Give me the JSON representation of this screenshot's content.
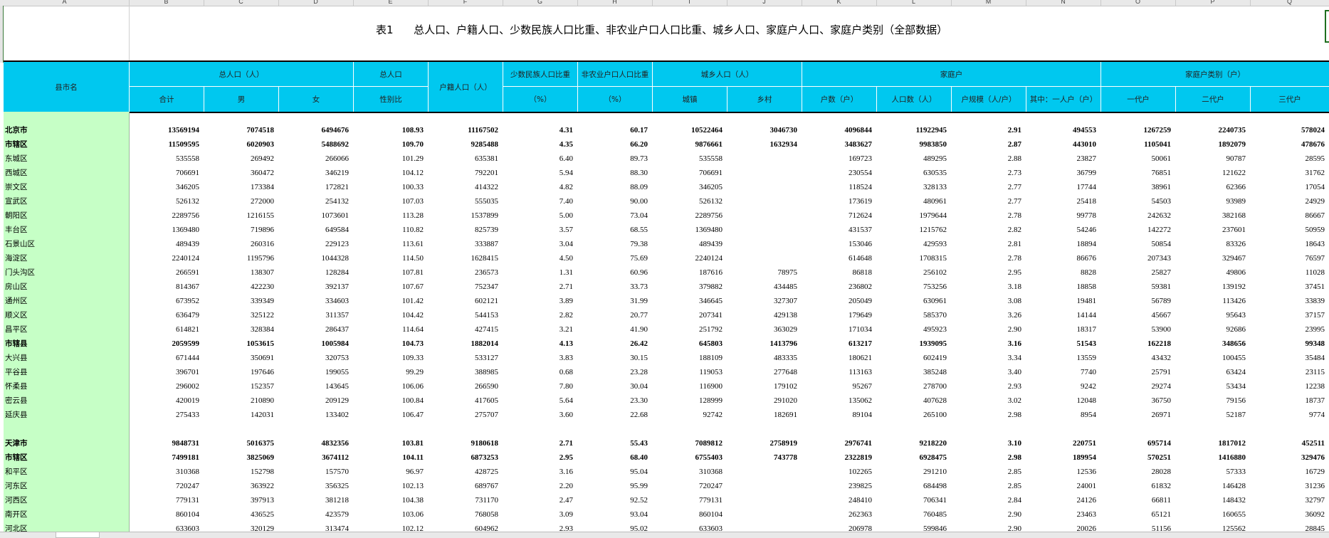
{
  "column_letters": [
    "A",
    "B",
    "C",
    "D",
    "E",
    "F",
    "G",
    "H",
    "I",
    "J",
    "K",
    "L",
    "M",
    "N",
    "O",
    "P",
    "Q"
  ],
  "title": "表1      总人口、户籍人口、少数民族人口比重、非农业户口人口比重、城乡人口、家庭户人口、家庭户类别（全部数据）",
  "header": {
    "region": "县市名",
    "groups": {
      "total_pop": "总人口（人）",
      "sex_ratio": "总人口",
      "household_reg": "户籍人口（人）",
      "minority": "少数民族人口比重",
      "nonagri": "非农业户口人口比重",
      "urban_rural": "城乡人口（人）",
      "household": "家庭户",
      "household_type": "家庭户类别（户）"
    },
    "sub": {
      "total": "合计",
      "male": "男",
      "female": "女",
      "sex_ratio": "性别比",
      "minority_pct": "（%）",
      "nonagri_pct": "（%）",
      "urban": "城镇",
      "rural": "乡村",
      "hh_count": "户数（户）",
      "hh_pop": "人口数（人）",
      "hh_size": "户规模（人/户）",
      "hh_single": "其中：一人户（户）",
      "gen1": "一代户",
      "gen2": "二代户",
      "gen3": "三代户"
    }
  },
  "rows": [
    {
      "name": "北京市",
      "bold": true,
      "v": [
        "13569194",
        "7074518",
        "6494676",
        "108.93",
        "11167502",
        "4.31",
        "60.17",
        "10522464",
        "3046730",
        "4096844",
        "11922945",
        "2.91",
        "494553",
        "1267259",
        "2240735",
        "578024"
      ]
    },
    {
      "name": "市辖区",
      "bold": true,
      "v": [
        "11509595",
        "6020903",
        "5488692",
        "109.70",
        "9285488",
        "4.35",
        "66.20",
        "9876661",
        "1632934",
        "3483627",
        "9983850",
        "2.87",
        "443010",
        "1105041",
        "1892079",
        "478676"
      ]
    },
    {
      "name": "东城区",
      "bold": false,
      "v": [
        "535558",
        "269492",
        "266066",
        "101.29",
        "635381",
        "6.40",
        "89.73",
        "535558",
        "",
        "169723",
        "489295",
        "2.88",
        "23827",
        "50061",
        "90787",
        "28595"
      ]
    },
    {
      "name": "西城区",
      "bold": false,
      "v": [
        "706691",
        "360472",
        "346219",
        "104.12",
        "792201",
        "5.94",
        "88.30",
        "706691",
        "",
        "230554",
        "630535",
        "2.73",
        "36799",
        "76851",
        "121622",
        "31762"
      ]
    },
    {
      "name": "崇文区",
      "bold": false,
      "v": [
        "346205",
        "173384",
        "172821",
        "100.33",
        "414322",
        "4.82",
        "88.09",
        "346205",
        "",
        "118524",
        "328133",
        "2.77",
        "17744",
        "38961",
        "62366",
        "17054"
      ]
    },
    {
      "name": "宣武区",
      "bold": false,
      "v": [
        "526132",
        "272000",
        "254132",
        "107.03",
        "555035",
        "7.40",
        "90.00",
        "526132",
        "",
        "173619",
        "480961",
        "2.77",
        "25418",
        "54503",
        "93989",
        "24929"
      ]
    },
    {
      "name": "朝阳区",
      "bold": false,
      "v": [
        "2289756",
        "1216155",
        "1073601",
        "113.28",
        "1537899",
        "5.00",
        "73.04",
        "2289756",
        "",
        "712624",
        "1979644",
        "2.78",
        "99778",
        "242632",
        "382168",
        "86667"
      ]
    },
    {
      "name": "丰台区",
      "bold": false,
      "v": [
        "1369480",
        "719896",
        "649584",
        "110.82",
        "825739",
        "3.57",
        "68.55",
        "1369480",
        "",
        "431537",
        "1215762",
        "2.82",
        "54246",
        "142272",
        "237601",
        "50959"
      ]
    },
    {
      "name": "石景山区",
      "bold": false,
      "v": [
        "489439",
        "260316",
        "229123",
        "113.61",
        "333887",
        "3.04",
        "79.38",
        "489439",
        "",
        "153046",
        "429593",
        "2.81",
        "18894",
        "50854",
        "83326",
        "18643"
      ]
    },
    {
      "name": "海淀区",
      "bold": false,
      "v": [
        "2240124",
        "1195796",
        "1044328",
        "114.50",
        "1628415",
        "4.50",
        "75.69",
        "2240124",
        "",
        "614648",
        "1708315",
        "2.78",
        "86676",
        "207343",
        "329467",
        "76597"
      ]
    },
    {
      "name": "门头沟区",
      "bold": false,
      "v": [
        "266591",
        "138307",
        "128284",
        "107.81",
        "236573",
        "1.31",
        "60.96",
        "187616",
        "78975",
        "86818",
        "256102",
        "2.95",
        "8828",
        "25827",
        "49806",
        "11028"
      ]
    },
    {
      "name": "房山区",
      "bold": false,
      "v": [
        "814367",
        "422230",
        "392137",
        "107.67",
        "752347",
        "2.71",
        "33.73",
        "379882",
        "434485",
        "236802",
        "753256",
        "3.18",
        "18858",
        "59381",
        "139192",
        "37451"
      ]
    },
    {
      "name": "通州区",
      "bold": false,
      "v": [
        "673952",
        "339349",
        "334603",
        "101.42",
        "602121",
        "3.89",
        "31.99",
        "346645",
        "327307",
        "205049",
        "630961",
        "3.08",
        "19481",
        "56789",
        "113426",
        "33839"
      ]
    },
    {
      "name": "顺义区",
      "bold": false,
      "v": [
        "636479",
        "325122",
        "311357",
        "104.42",
        "544153",
        "2.82",
        "20.77",
        "207341",
        "429138",
        "179649",
        "585370",
        "3.26",
        "14144",
        "45667",
        "95643",
        "37157"
      ]
    },
    {
      "name": "昌平区",
      "bold": false,
      "v": [
        "614821",
        "328384",
        "286437",
        "114.64",
        "427415",
        "3.21",
        "41.90",
        "251792",
        "363029",
        "171034",
        "495923",
        "2.90",
        "18317",
        "53900",
        "92686",
        "23995"
      ]
    },
    {
      "name": "市辖县",
      "bold": true,
      "v": [
        "2059599",
        "1053615",
        "1005984",
        "104.73",
        "1882014",
        "4.13",
        "26.42",
        "645803",
        "1413796",
        "613217",
        "1939095",
        "3.16",
        "51543",
        "162218",
        "348656",
        "99348"
      ]
    },
    {
      "name": "大兴县",
      "bold": false,
      "v": [
        "671444",
        "350691",
        "320753",
        "109.33",
        "533127",
        "3.83",
        "30.15",
        "188109",
        "483335",
        "180621",
        "602419",
        "3.34",
        "13559",
        "43432",
        "100455",
        "35484"
      ]
    },
    {
      "name": "平谷县",
      "bold": false,
      "v": [
        "396701",
        "197646",
        "199055",
        "99.29",
        "388985",
        "0.68",
        "23.28",
        "119053",
        "277648",
        "113163",
        "385248",
        "3.40",
        "7740",
        "25791",
        "63424",
        "23115"
      ]
    },
    {
      "name": "怀柔县",
      "bold": false,
      "v": [
        "296002",
        "152357",
        "143645",
        "106.06",
        "266590",
        "7.80",
        "30.04",
        "116900",
        "179102",
        "95267",
        "278700",
        "2.93",
        "9242",
        "29274",
        "53434",
        "12238"
      ]
    },
    {
      "name": "密云县",
      "bold": false,
      "v": [
        "420019",
        "210890",
        "209129",
        "100.84",
        "417605",
        "5.64",
        "23.30",
        "128999",
        "291020",
        "135062",
        "407628",
        "3.02",
        "12048",
        "36750",
        "79156",
        "18737"
      ]
    },
    {
      "name": "延庆县",
      "bold": false,
      "v": [
        "275433",
        "142031",
        "133402",
        "106.47",
        "275707",
        "3.60",
        "22.68",
        "92742",
        "182691",
        "89104",
        "265100",
        "2.98",
        "8954",
        "26971",
        "52187",
        "9774"
      ]
    },
    {
      "name": "",
      "bold": false,
      "v": [
        "",
        "",
        "",
        "",
        "",
        "",
        "",
        "",
        "",
        "",
        "",
        "",
        "",
        "",
        "",
        ""
      ]
    },
    {
      "name": "天津市",
      "bold": true,
      "v": [
        "9848731",
        "5016375",
        "4832356",
        "103.81",
        "9180618",
        "2.71",
        "55.43",
        "7089812",
        "2758919",
        "2976741",
        "9218220",
        "3.10",
        "220751",
        "695714",
        "1817012",
        "452511"
      ]
    },
    {
      "name": "市辖区",
      "bold": true,
      "v": [
        "7499181",
        "3825069",
        "3674112",
        "104.11",
        "6873253",
        "2.95",
        "68.40",
        "6755403",
        "743778",
        "2322819",
        "6928475",
        "2.98",
        "189954",
        "570251",
        "1416880",
        "329476"
      ]
    },
    {
      "name": "和平区",
      "bold": false,
      "v": [
        "310368",
        "152798",
        "157570",
        "96.97",
        "428725",
        "3.16",
        "95.04",
        "310368",
        "",
        "102265",
        "291210",
        "2.85",
        "12536",
        "28028",
        "57333",
        "16729"
      ]
    },
    {
      "name": "河东区",
      "bold": false,
      "v": [
        "720247",
        "363922",
        "356325",
        "102.13",
        "689767",
        "2.20",
        "95.99",
        "720247",
        "",
        "239825",
        "684498",
        "2.85",
        "24001",
        "61832",
        "146428",
        "31236"
      ]
    },
    {
      "name": "河西区",
      "bold": false,
      "v": [
        "779131",
        "397913",
        "381218",
        "104.38",
        "731170",
        "2.47",
        "92.52",
        "779131",
        "",
        "248410",
        "706341",
        "2.84",
        "24126",
        "66811",
        "148432",
        "32797"
      ]
    },
    {
      "name": "南开区",
      "bold": false,
      "v": [
        "860104",
        "436525",
        "423579",
        "103.06",
        "768058",
        "3.09",
        "93.04",
        "860104",
        "",
        "262363",
        "760485",
        "2.90",
        "23463",
        "65121",
        "160655",
        "36092"
      ]
    },
    {
      "name": "河北区",
      "bold": false,
      "v": [
        "633603",
        "320129",
        "313474",
        "102.12",
        "604962",
        "2.93",
        "95.02",
        "633603",
        "",
        "206978",
        "599846",
        "2.90",
        "20026",
        "51156",
        "125562",
        "28845"
      ]
    }
  ]
}
